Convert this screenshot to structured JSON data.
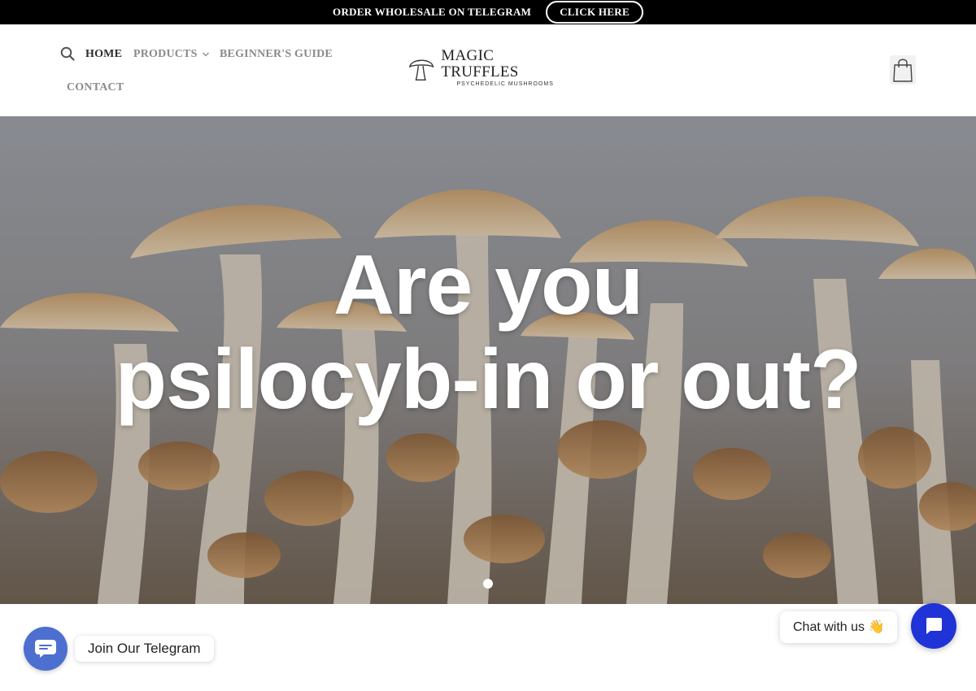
{
  "announcement": {
    "text": "ORDER WHOLESALE ON TELEGRAM",
    "button_label": "CLICK HERE"
  },
  "nav": {
    "home": "HOME",
    "products": "PRODUCTS",
    "guide": "BEGINNER'S GUIDE",
    "contact": "CONTACT"
  },
  "logo": {
    "title": "MAGIC TRUFFLES",
    "subtitle": "PSYCHEDELIC  MUSHROOMS"
  },
  "hero": {
    "line1": "Are you",
    "line2": "psilocyb-in or out?",
    "slide_count": 1,
    "active_slide": 1
  },
  "widgets": {
    "telegram_label": "Join Our Telegram",
    "chat_label": "Chat with us",
    "chat_emoji": "👋"
  },
  "icons": {
    "search": "search-icon",
    "cart": "shopping-bag-icon",
    "telegram": "telegram-icon",
    "chat": "chat-bubble-icon"
  },
  "colors": {
    "topbar_bg": "#000000",
    "nav_active": "#2c2c2c",
    "nav_inactive": "#8a8a8a",
    "telegram_button": "#4d6fcf",
    "chat_button": "#1f33d6"
  }
}
